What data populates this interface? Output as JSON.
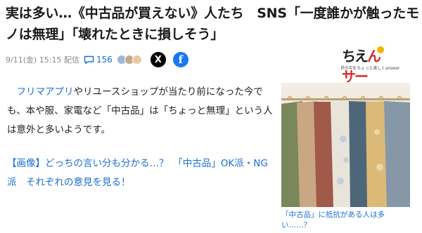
{
  "article": {
    "headline": "実は多い…《中古品が買えない》人たち　SNS「一度誰かが触ったモノは無理」「壊れたときに損しそう」",
    "date": "9/11(金) 15:15 配信",
    "comment_count": "156",
    "share_x_label": "X",
    "share_facebook_label": "f"
  },
  "logo": {
    "text_part1": "ちえ",
    "text_part2": "んサー",
    "subtitle": "世の中をちょっと楽しくanswer"
  },
  "body": {
    "link_text": "フリマアプリ",
    "text": "やリユースショップが当たり前になった今でも、本や服、家電など「中古品」は「ちょっと無理」という人は意外と多いようです。"
  },
  "promo": {
    "text": "【画像】どっちの言い分も分かる…？　「中古品」OK派・NG派　それぞれの意見を見る！"
  },
  "photo": {
    "caption": "「中古品」に抵抗がある人は多い……？"
  },
  "colors": {
    "link": "#1a6fd1",
    "x_brand": "#000000",
    "facebook_brand": "#1877f2",
    "logo_accent": "#d62828"
  },
  "icons": {
    "comments": "speech-bubble-icon",
    "x": "x-logo-icon",
    "facebook": "facebook-logo-icon"
  }
}
